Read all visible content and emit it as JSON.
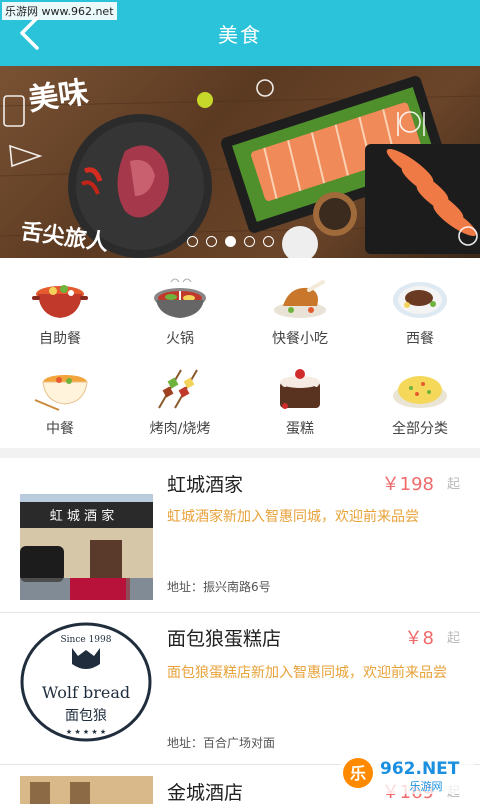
{
  "watermark_top": "乐游网 www.962.net",
  "header": {
    "title": "美食"
  },
  "banner": {
    "text1": "美味",
    "text2": "舌尖旅人",
    "slide_count": 5,
    "active_slide": 3
  },
  "categories": [
    {
      "label": "自助餐",
      "icon": "stew-pot-icon"
    },
    {
      "label": "火锅",
      "icon": "hotpot-icon"
    },
    {
      "label": "快餐小吃",
      "icon": "roast-chicken-icon"
    },
    {
      "label": "西餐",
      "icon": "steak-plate-icon"
    },
    {
      "label": "中餐",
      "icon": "noodle-bowl-icon"
    },
    {
      "label": "烤肉/烧烤",
      "icon": "skewers-icon"
    },
    {
      "label": "蛋糕",
      "icon": "cake-icon"
    },
    {
      "label": "全部分类",
      "icon": "fried-rice-icon"
    }
  ],
  "listings": [
    {
      "name": "虹城酒家",
      "price": "￥198",
      "suffix": "起",
      "desc": "虹城酒家新加入智惠同城，欢迎前来品尝",
      "addr": "地址：振兴南路6号",
      "sign": "虹 城 酒 家"
    },
    {
      "name": "面包狼蛋糕店",
      "price": "￥8",
      "suffix": "起",
      "desc": "面包狼蛋糕店新加入智惠同城，欢迎前来品尝",
      "addr": "地址：百合广场对面",
      "logo_since": "Since 1998",
      "logo_text": "Wolf bread",
      "logo_cn": "面包狼"
    },
    {
      "name": "金城酒店",
      "price": "￥169",
      "suffix": "起"
    }
  ],
  "watermark_bottom": {
    "brand": "962.NET",
    "sub": "乐游网"
  }
}
